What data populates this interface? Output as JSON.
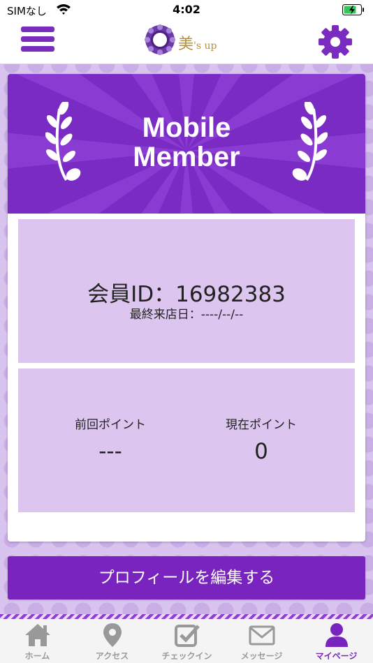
{
  "status_bar": {
    "carrier": "SIMなし",
    "time": "4:02"
  },
  "header": {
    "logo_text": "美",
    "logo_suffix": "'s up",
    "menu_icon": "hamburger-menu-icon",
    "settings_icon": "gear-icon"
  },
  "banner": {
    "title_line1": "Mobile",
    "title_line2": "Member"
  },
  "member": {
    "id_text": "会員ID：16982383",
    "last_visit_text": "最終来店日：----/--/--"
  },
  "points": {
    "previous_label": "前回ポイント",
    "previous_value": "---",
    "current_label": "現在ポイント",
    "current_value": "0"
  },
  "edit_profile_label": "プロフィールを編集する",
  "tabs": [
    {
      "label": "ホーム",
      "icon": "home-icon",
      "active": false
    },
    {
      "label": "アクセス",
      "icon": "map-pin-icon",
      "active": false
    },
    {
      "label": "チェックイン",
      "icon": "checkin-icon",
      "active": false
    },
    {
      "label": "メッセージ",
      "icon": "envelope-icon",
      "active": false
    },
    {
      "label": "マイページ",
      "icon": "user-icon",
      "active": true
    }
  ],
  "colors": {
    "brand_purple": "#7a24bf",
    "panel_lavender": "#dcc6ef",
    "logo_gold": "#b8913a"
  }
}
